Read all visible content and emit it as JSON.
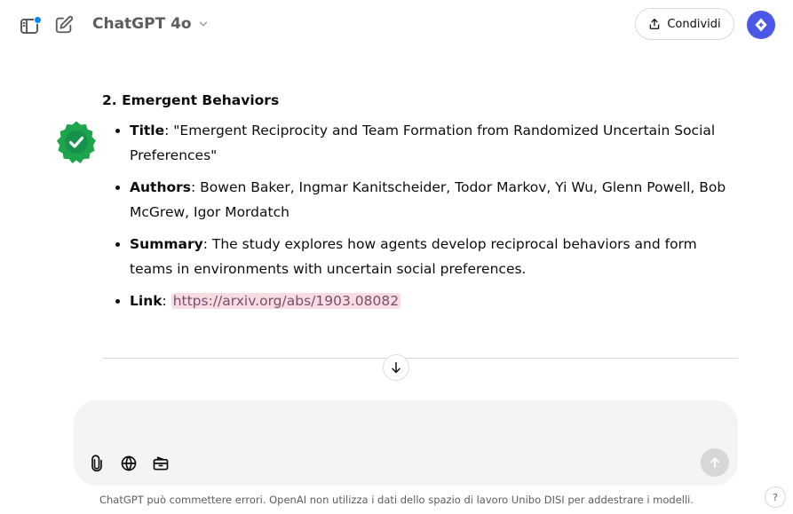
{
  "header": {
    "model_name": "ChatGPT 4o",
    "share_label": "Condividi"
  },
  "message": {
    "heading": "2. Emergent Behaviors",
    "items": [
      {
        "key": "Title",
        "sep": ": ",
        "value": "\"Emergent Reciprocity and Team Formation from Randomized Uncertain Social Preferences\""
      },
      {
        "key": "Authors",
        "sep": ": ",
        "value": "Bowen Baker, Ingmar Kanitscheider, Todor Markov, Yi Wu, Glenn Powell, Bob McGrew, Igor Mordatch"
      },
      {
        "key": "Summary",
        "sep": ": ",
        "value": "The study explores how agents develop reciprocal behaviors and form teams in environments with uncertain social preferences."
      },
      {
        "key": "Link",
        "sep": ": ",
        "value": "https://arxiv.org/abs/1903.08082"
      }
    ]
  },
  "composer": {
    "placeholder": "",
    "value": ""
  },
  "footer": {
    "disclaimer": "ChatGPT può commettere errori. OpenAI non utilizza i dati dello spazio di lavoro Unibo DISI per addestrare i modelli.",
    "help_label": "?"
  },
  "colors": {
    "accent": "#4b57e8",
    "badge_green": "#1ea54b",
    "link_highlight": "#f7dde2",
    "notification_dot": "#0285ff"
  }
}
